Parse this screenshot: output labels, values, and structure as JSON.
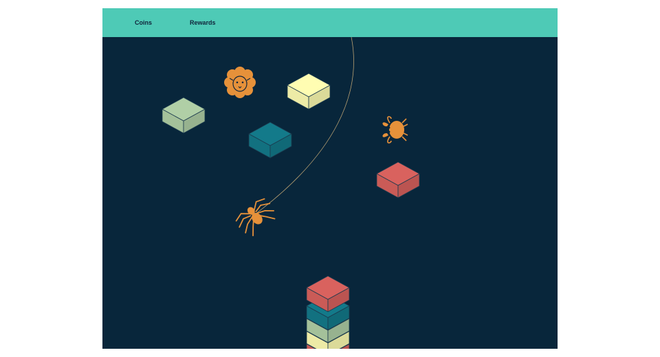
{
  "header": {
    "nav": [
      {
        "label": "Coins"
      },
      {
        "label": "Rewards"
      }
    ]
  },
  "colors": {
    "header_bg": "#4ecab6",
    "board_bg": "#08263b",
    "creature": "#e6913a",
    "thread": "#b8a072",
    "outline": "#1b3a4e",
    "block_red": "#d9625e",
    "block_teal": "#137a8a",
    "block_sage": "#b0cfa6",
    "block_yellow": "#fffdb2"
  },
  "scene": {
    "floating_blocks": [
      {
        "name": "floating-block-sage",
        "color": "block_sage"
      },
      {
        "name": "floating-block-yellow",
        "color": "block_yellow"
      },
      {
        "name": "floating-block-teal",
        "color": "block_teal"
      },
      {
        "name": "floating-block-red",
        "color": "block_red"
      }
    ],
    "tower_blocks": [
      "block_red",
      "block_yellow",
      "block_sage",
      "block_teal",
      "block_red"
    ],
    "creatures": [
      {
        "name": "sheep-icon"
      },
      {
        "name": "crab-icon"
      },
      {
        "name": "spider-icon"
      }
    ]
  }
}
